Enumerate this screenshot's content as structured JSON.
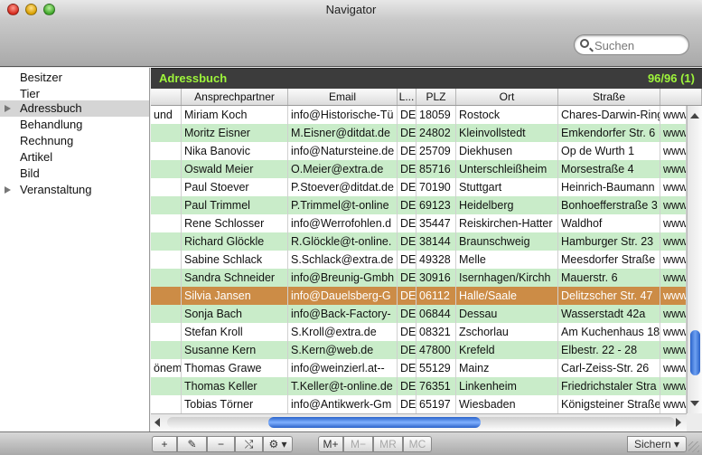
{
  "window": {
    "title": "Navigator"
  },
  "search": {
    "placeholder": "Suchen"
  },
  "sidebar": {
    "items": [
      {
        "label": "Besitzer",
        "expandable": false,
        "selected": false
      },
      {
        "label": "Tier",
        "expandable": false,
        "selected": false
      },
      {
        "label": "Adressbuch",
        "expandable": true,
        "selected": true
      },
      {
        "label": "Behandlung",
        "expandable": false,
        "selected": false
      },
      {
        "label": "Rechnung",
        "expandable": false,
        "selected": false
      },
      {
        "label": "Artikel",
        "expandable": false,
        "selected": false
      },
      {
        "label": "Bild",
        "expandable": false,
        "selected": false
      },
      {
        "label": "Veranstaltung",
        "expandable": true,
        "selected": false
      }
    ]
  },
  "pane": {
    "title": "Adressbuch",
    "count": "96/96 (1)"
  },
  "table": {
    "columns": [
      "",
      "Ansprechpartner",
      "Email",
      "L...",
      "PLZ",
      "Ort",
      "Straße",
      ""
    ],
    "rows": [
      [
        "und",
        "Miriam Koch",
        "info@Historische-Tü",
        "DE",
        "18059",
        "Rostock",
        "Chares-Darwin-Ring",
        "www"
      ],
      [
        "",
        "Moritz Eisner",
        "M.Eisner@ditdat.de",
        "DE",
        "24802",
        "Kleinvollstedt",
        "Emkendorfer Str. 6",
        "www"
      ],
      [
        "",
        "Nika Banovic",
        "info@Natursteine.de",
        "DE",
        "25709",
        "Diekhusen",
        "Op de Wurth 1",
        "www"
      ],
      [
        "",
        "Oswald Meier",
        "O.Meier@extra.de",
        "DE",
        "85716",
        "Unterschleißheim",
        "Morsestraße 4",
        "www"
      ],
      [
        "",
        "Paul Stoever",
        "P.Stoever@ditdat.de",
        "DE",
        "70190",
        "Stuttgart",
        "Heinrich-Baumann",
        "www"
      ],
      [
        "",
        "Paul Trimmel",
        "P.Trimmel@t-online",
        "DE",
        "69123",
        "Heidelberg",
        "Bonhoefferstraße 3",
        "www"
      ],
      [
        "",
        "Rene Schlosser",
        "info@Werrofohlen.d",
        "DE",
        "35447",
        "Reiskirchen-Hatter",
        "Waldhof",
        "www"
      ],
      [
        "",
        "Richard Glöckle",
        "R.Glöckle@t-online.",
        "DE",
        "38144",
        "Braunschweig",
        "Hamburger Str. 23",
        "www"
      ],
      [
        "",
        "Sabine Schlack",
        "S.Schlack@extra.de",
        "DE",
        "49328",
        "Melle",
        "Meesdorfer Straße",
        "www"
      ],
      [
        "",
        "Sandra Schneider",
        "info@Breunig-Gmbh",
        "DE",
        "30916",
        "Isernhagen/Kirchh",
        "Mauerstr. 6",
        "www"
      ],
      [
        "",
        "Silvia Jansen",
        "info@Dauelsberg-G",
        "DE",
        "06112",
        "Halle/Saale",
        "Delitzscher Str. 47",
        "www"
      ],
      [
        "",
        "Sonja Bach",
        "info@Back-Factory-",
        "DE",
        "06844",
        "Dessau",
        "Wasserstadt 42a",
        "www"
      ],
      [
        "",
        "Stefan Kroll",
        "S.Kroll@extra.de",
        "DE",
        "08321",
        "Zschorlau",
        "Am Kuchenhaus 18",
        "www"
      ],
      [
        "",
        "Susanne Kern",
        "S.Kern@web.de",
        "DE",
        "47800",
        "Krefeld",
        "Elbestr. 22 - 28",
        "www"
      ],
      [
        "önem",
        "Thomas Grawe",
        "info@weinzierl.at--",
        "DE",
        "55129",
        "Mainz",
        "Carl-Zeiss-Str. 26",
        "www"
      ],
      [
        "",
        "Thomas Keller",
        "T.Keller@t-online.de",
        "DE",
        "76351",
        "Linkenheim",
        "Friedrichstaler Stra",
        "www"
      ],
      [
        "",
        "Tobias Törner",
        "info@Antikwerk-Gm",
        "DE",
        "65197",
        "Wiesbaden",
        "Königsteiner Straße",
        "www"
      ]
    ],
    "selected_row": 10
  },
  "bottom": {
    "buttons": [
      "+",
      "✎",
      "−",
      "⤭",
      "⚙ ▾"
    ],
    "memory": [
      "M+",
      "M−",
      "MR",
      "MC"
    ],
    "save_label": "Sichern"
  },
  "colors": {
    "accent": "#9ef53b",
    "row_alt": "#c9ecc9",
    "row_selected": "#cc8c46"
  }
}
